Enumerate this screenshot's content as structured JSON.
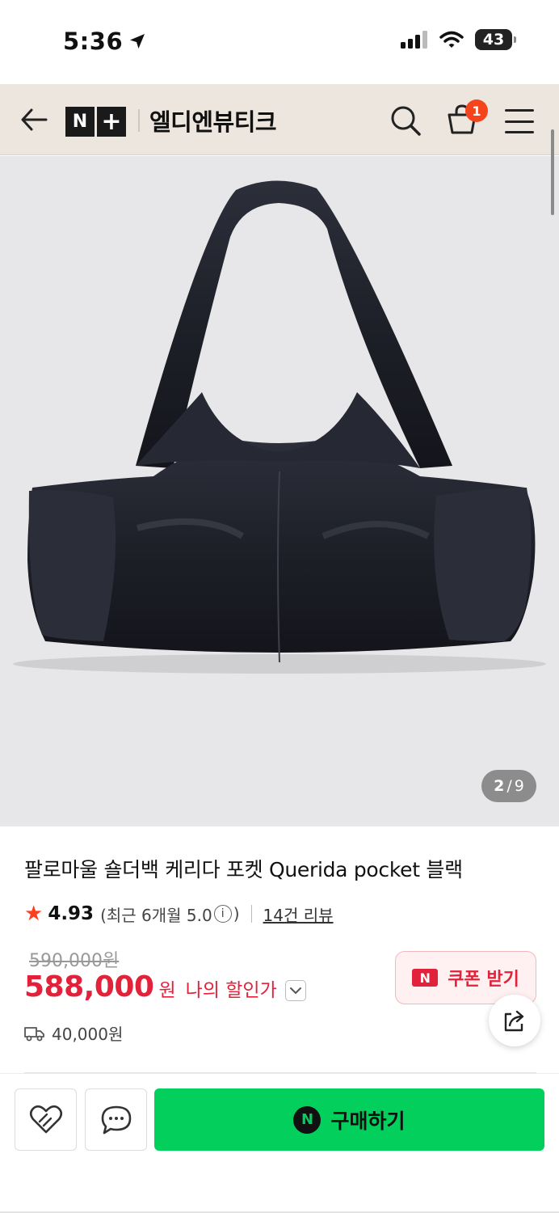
{
  "status_bar": {
    "time": "5:36",
    "battery": "43"
  },
  "header": {
    "logo_n": "N",
    "logo_plus": "+",
    "store_name": "엘디엔뷰티크",
    "cart_count": "1"
  },
  "gallery": {
    "current": "2",
    "separator": "/",
    "total": "9"
  },
  "product": {
    "title": "팔로마울 숄더백 케리다 포켓 Querida pocket 블랙",
    "rating_star": "★",
    "rating": "4.93",
    "recent_rating_prefix": "(최근 6개월 5.0",
    "info_symbol": "i",
    "recent_rating_suffix": ")",
    "review_count": "14건 리뷰",
    "original_price": "590,000원",
    "sale_price": "588,000",
    "price_unit": "원",
    "my_price_label": "나의 할인가",
    "shipping_fee": "40,000원"
  },
  "coupon": {
    "logo": "N",
    "label": "쿠폰 받기"
  },
  "bottom_bar": {
    "buy_icon": "N",
    "buy_label": "구매하기"
  },
  "colors": {
    "header_bg": "#ede6df",
    "price_red": "#e2213a",
    "buy_green": "#03cf5d",
    "badge_orange": "#f5441b",
    "rating_star": "#ff3d1f"
  },
  "icons": {
    "status": [
      "location-arrow-icon",
      "cellular-signal-icon",
      "wifi-icon",
      "battery-icon"
    ],
    "header": [
      "back-arrow-icon",
      "search-icon",
      "shopping-bag-icon",
      "menu-icon"
    ],
    "product": [
      "star-icon",
      "info-icon",
      "chevron-down-icon",
      "delivery-truck-icon",
      "share-icon"
    ],
    "bottom": [
      "heart-icon",
      "chat-bubble-icon",
      "naver-n-icon"
    ]
  }
}
